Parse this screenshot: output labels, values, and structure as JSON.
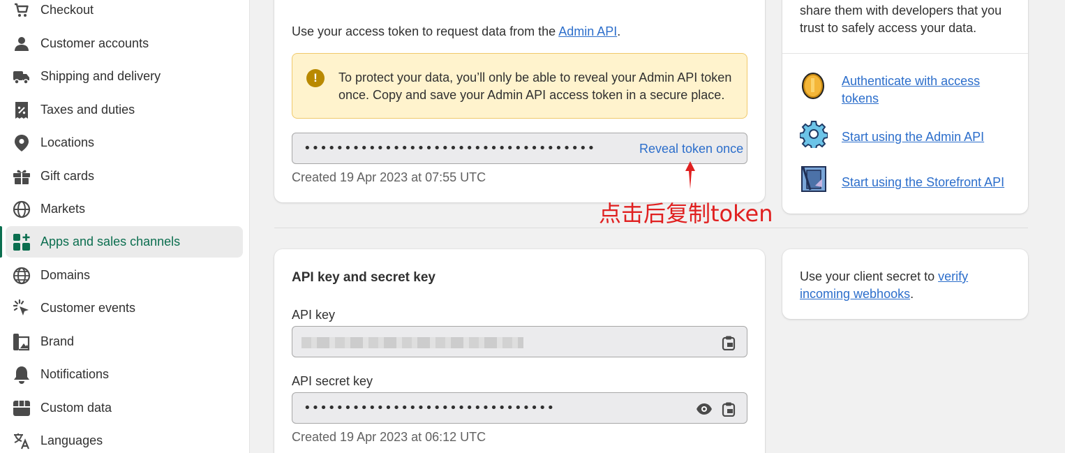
{
  "sidebar": {
    "items": [
      {
        "label": "Checkout",
        "icon": "cart-icon"
      },
      {
        "label": "Customer accounts",
        "icon": "person-icon"
      },
      {
        "label": "Shipping and delivery",
        "icon": "truck-icon"
      },
      {
        "label": "Taxes and duties",
        "icon": "tax-receipt-icon"
      },
      {
        "label": "Locations",
        "icon": "location-pin-icon"
      },
      {
        "label": "Gift cards",
        "icon": "gift-icon"
      },
      {
        "label": "Markets",
        "icon": "globe-markets-icon"
      },
      {
        "label": "Apps and sales channels",
        "icon": "apps-icon",
        "active": true
      },
      {
        "label": "Domains",
        "icon": "globe-icon"
      },
      {
        "label": "Customer events",
        "icon": "cursor-click-icon"
      },
      {
        "label": "Brand",
        "icon": "brand-image-icon"
      },
      {
        "label": "Notifications",
        "icon": "bell-icon"
      },
      {
        "label": "Custom data",
        "icon": "database-icon"
      },
      {
        "label": "Languages",
        "icon": "translate-icon"
      }
    ]
  },
  "access_token": {
    "intro_prefix": "Use your access token to request data from the ",
    "intro_link": "Admin API",
    "intro_suffix": ".",
    "banner": "To protect your data, you’ll only be able to reveal your Admin API token once. Copy and save your Admin API access token in a secure place.",
    "masked_token": "••••••••••••••••••••••••••••••••••••",
    "reveal_label": "Reveal token once",
    "created": "Created 19 Apr 2023 at 07:55 UTC"
  },
  "annotation": {
    "text": "点击后复制token",
    "color": "#e02020"
  },
  "api_keys": {
    "title": "API key and secret key",
    "api_key_label": "API key",
    "secret_label": "API secret key",
    "masked_secret": "•••••••••••••••••••••••••••••••",
    "created": "Created 19 Apr 2023 at 06:12 UTC"
  },
  "resources": {
    "top_text_line1": "share them with developers that you",
    "top_text_line2": "trust to safely access your data.",
    "links": [
      {
        "line1": "Authenticate with access",
        "line2": "tokens",
        "icon": "coin-icon"
      },
      {
        "line1": "Start using the Admin API",
        "line2": "",
        "icon": "gear-icon"
      },
      {
        "line1": "Start using the Storefront API",
        "line2": "",
        "icon": "storefront-icon"
      }
    ]
  },
  "webhooks": {
    "prefix": "Use your client secret to ",
    "link_line1": "verify",
    "link_line2": "incoming webhooks",
    "suffix": "."
  },
  "colors": {
    "accent": "#0b6e4f",
    "link": "#2c6ecb",
    "warning_bg": "#fff3cd"
  }
}
